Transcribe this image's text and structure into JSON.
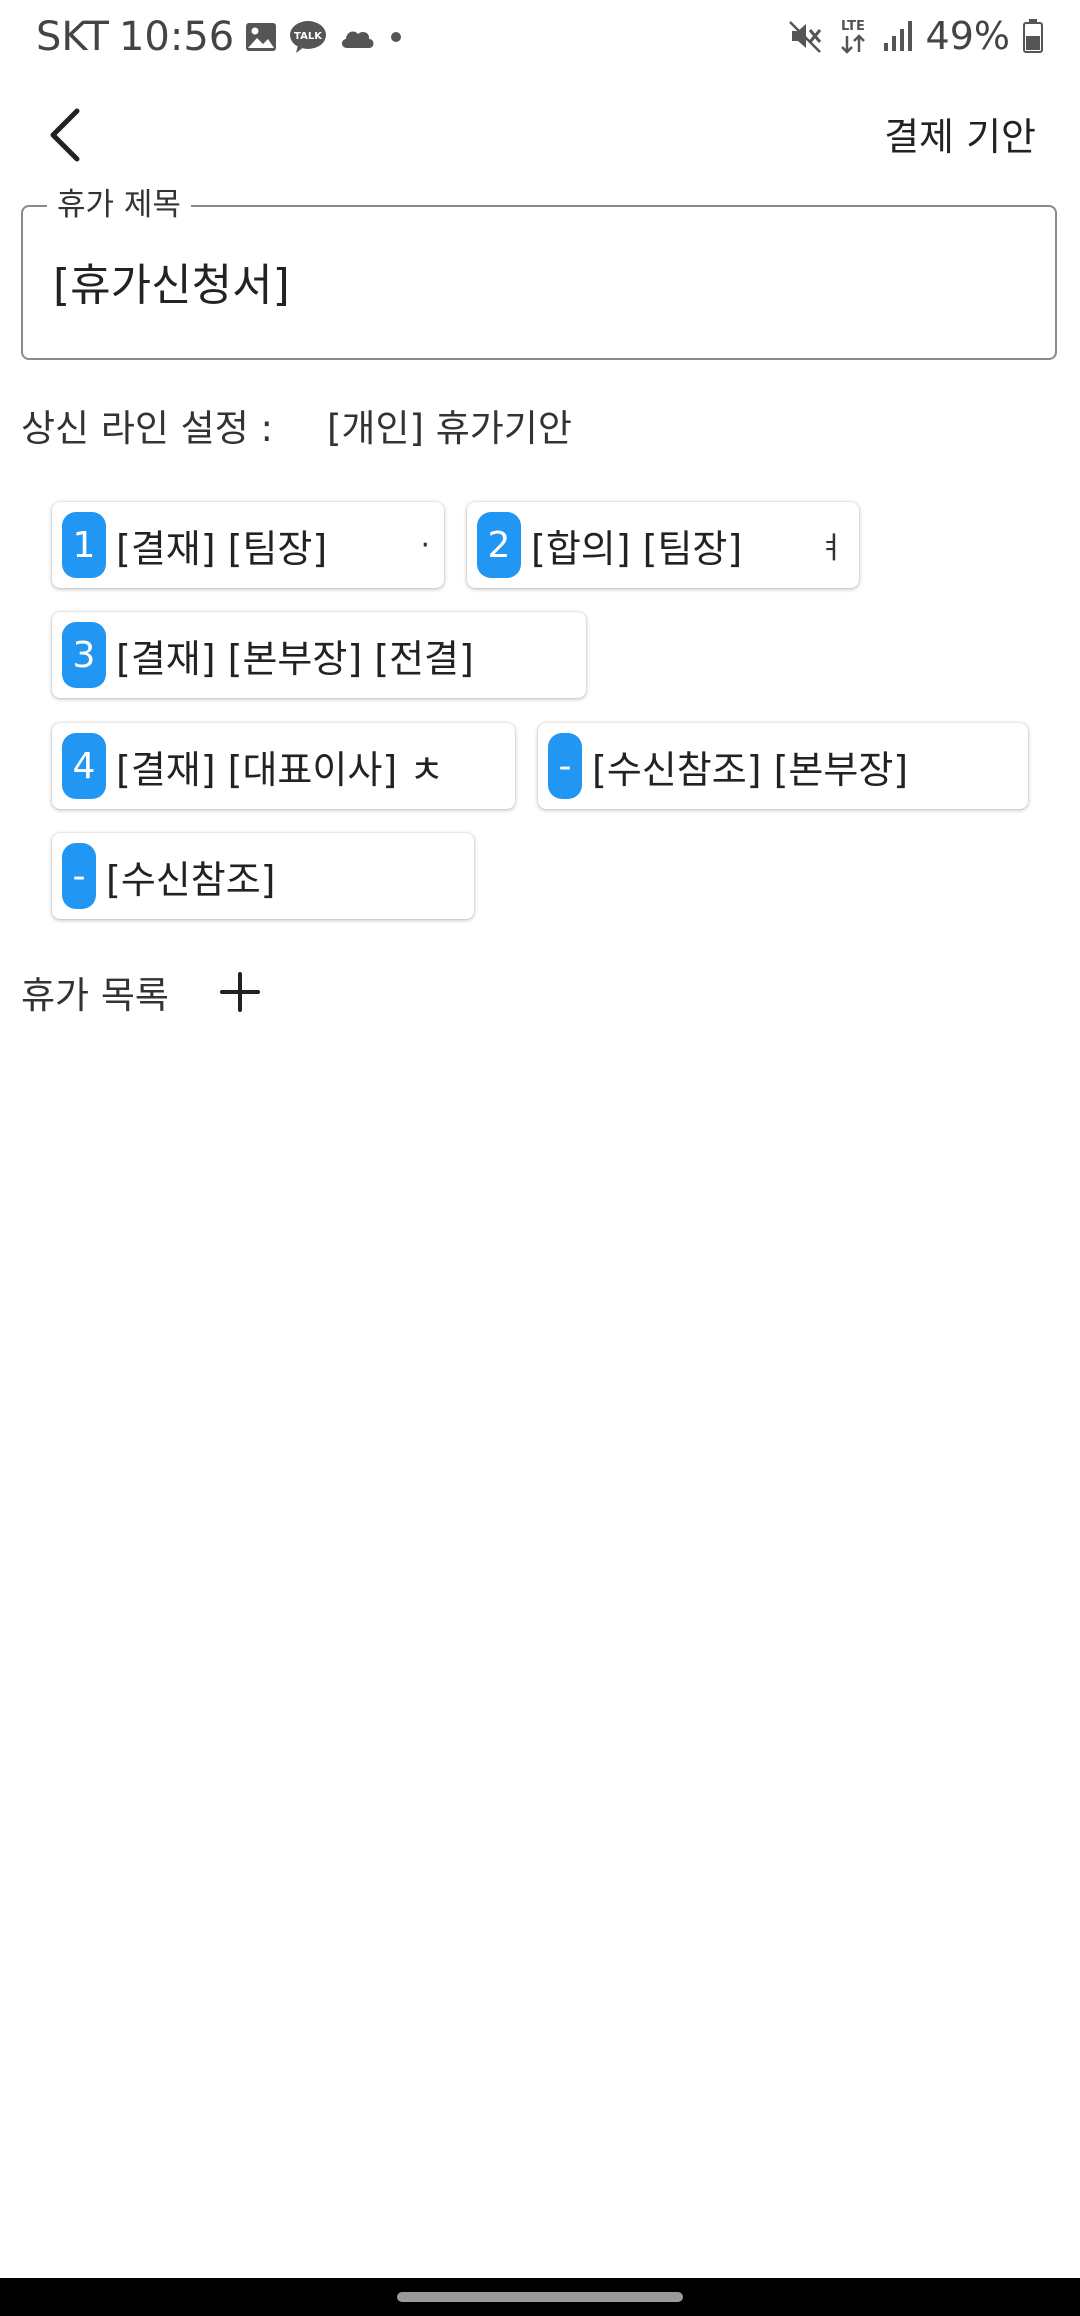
{
  "status_bar": {
    "carrier": "SKT",
    "time": "10:56",
    "battery_percent": "49%",
    "network": "LTE",
    "icons": [
      "gallery-icon",
      "kakaotalk-icon",
      "cloud-icon",
      "dot-icon",
      "mute-icon",
      "lte-icon",
      "signal-icon",
      "battery-icon"
    ],
    "kakaotalk_label": "TALK"
  },
  "app_bar": {
    "action_label": "결제 기안"
  },
  "title_field": {
    "label": "휴가 제목",
    "value": "[휴가신청서]"
  },
  "approval_line": {
    "label": "상신 라인 설정 :",
    "value": "[개인] 휴가기안"
  },
  "approvers": [
    {
      "badge": "1",
      "label": "[결재] [팀장]",
      "tail": "·"
    },
    {
      "badge": "2",
      "label": "[합의] [팀장]",
      "tail": "ㅕ"
    },
    {
      "badge": "3",
      "label": "[결재] [본부장] [전결]",
      "tail": ""
    },
    {
      "badge": "4",
      "label": "[결재] [대표이사] ㅊ",
      "tail": ""
    },
    {
      "badge": "-",
      "label": "[수신참조] [본부장]",
      "tail": ""
    },
    {
      "badge": "-",
      "label": "[수신참조]",
      "tail": ""
    }
  ],
  "vacation_list": {
    "label": "휴가 목록"
  },
  "colors": {
    "badge": "#2196F3",
    "nav_bar": "#000000"
  }
}
